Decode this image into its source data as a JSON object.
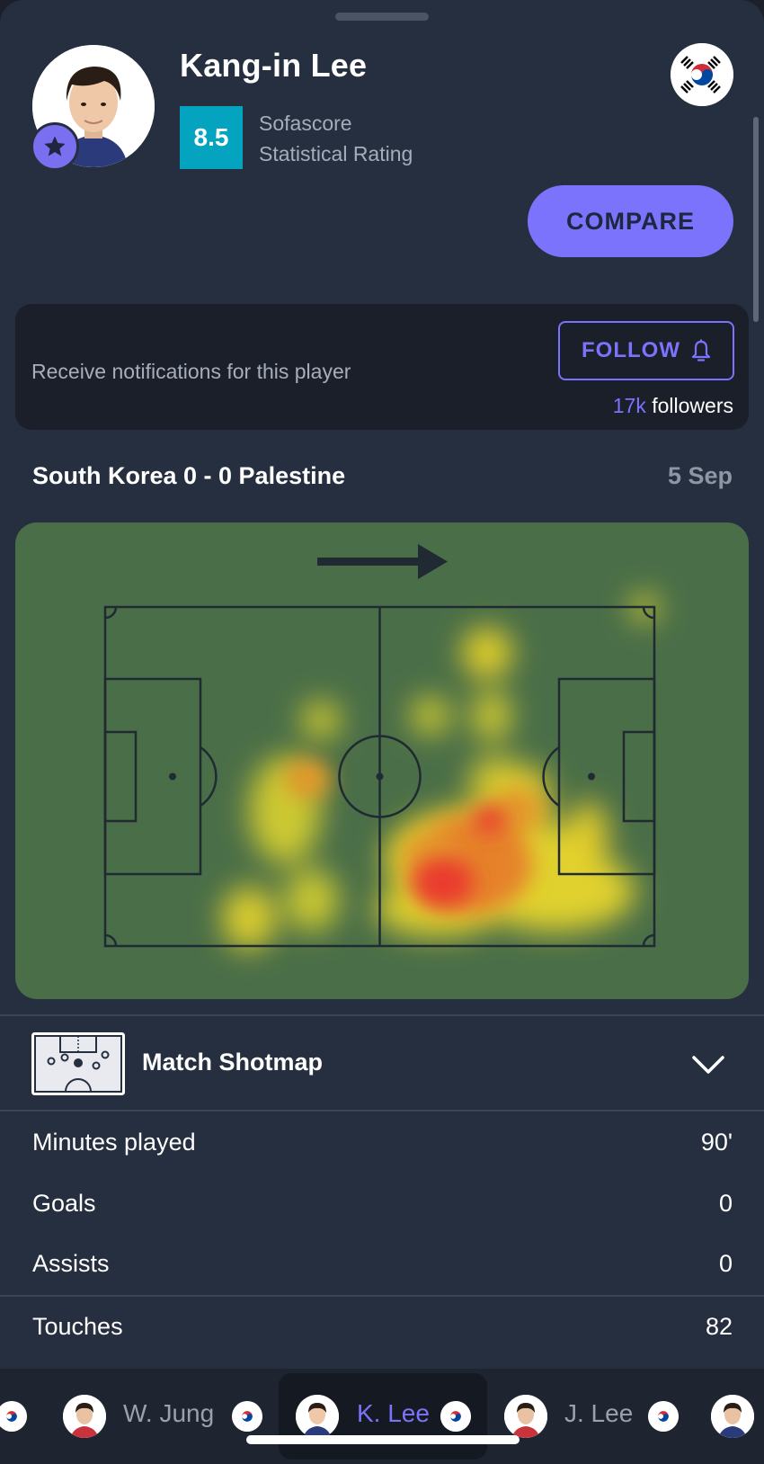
{
  "player": {
    "name": "Kang-in Lee",
    "rating": "8.5",
    "rating_label_line1": "Sofascore",
    "rating_label_line2": "Statistical Rating",
    "avatar_icon": "player-portrait",
    "badge_icon": "star-icon",
    "flag_icon": "south-korea-flag"
  },
  "actions": {
    "compare_label": "COMPARE"
  },
  "notifications": {
    "text": "Receive notifications for this player",
    "follow_label": "FOLLOW",
    "follow_icon": "bell-icon",
    "followers_count": "17k",
    "followers_label": "followers"
  },
  "match": {
    "title": "South Korea 0 - 0 Palestine",
    "date": "5 Sep",
    "heatmap_direction_icon": "arrow-right-icon"
  },
  "shotmap": {
    "label": "Match Shotmap",
    "icon": "pitch-shotmap-icon",
    "toggle_icon": "chevron-down-icon"
  },
  "stats": [
    {
      "label": "Minutes played",
      "value": "90'"
    },
    {
      "label": "Goals",
      "value": "0"
    },
    {
      "label": "Assists",
      "value": "0"
    },
    {
      "label": "Touches",
      "value": "82"
    }
  ],
  "bottom_nav": {
    "players": [
      {
        "name": "W. Jung",
        "selected": false
      },
      {
        "name": "K. Lee",
        "selected": true
      },
      {
        "name": "J. Lee",
        "selected": false
      }
    ]
  },
  "colors": {
    "accent": "#7b73fb",
    "rating": "#04a3c0",
    "background": "#262f3f",
    "pitch": "#4a6e48"
  }
}
